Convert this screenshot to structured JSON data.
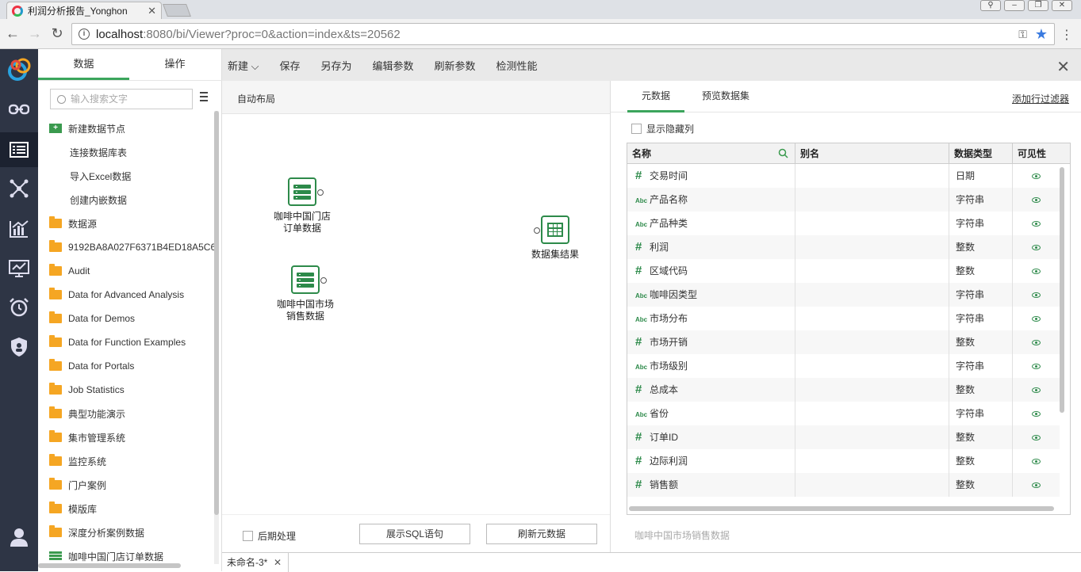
{
  "browser": {
    "tab_title": "利润分析报告_Yonghon",
    "url_host": "localhost",
    "url_path": ":8080/bi/Viewer?proc=0&action=index&ts=20562"
  },
  "left_panel": {
    "tabs": [
      "数据",
      "操作"
    ],
    "search_placeholder": "输入搜索文字",
    "tree": [
      {
        "label": "新建数据节点",
        "kind": "new"
      },
      {
        "label": "连接数据库表",
        "kind": "child"
      },
      {
        "label": "导入Excel数据",
        "kind": "child"
      },
      {
        "label": "创建内嵌数据",
        "kind": "child"
      },
      {
        "label": "数据源",
        "kind": "folder"
      },
      {
        "label": "9192BA8A027F6371B4ED18A5C6",
        "kind": "folder"
      },
      {
        "label": "Audit",
        "kind": "folder"
      },
      {
        "label": "Data for Advanced Analysis",
        "kind": "folder"
      },
      {
        "label": "Data for Demos",
        "kind": "folder"
      },
      {
        "label": "Data for Function Examples",
        "kind": "folder"
      },
      {
        "label": "Data for Portals",
        "kind": "folder"
      },
      {
        "label": "Job Statistics",
        "kind": "folder"
      },
      {
        "label": "典型功能演示",
        "kind": "folder"
      },
      {
        "label": "集市管理系统",
        "kind": "folder"
      },
      {
        "label": "监控系统",
        "kind": "folder"
      },
      {
        "label": "门户案例",
        "kind": "folder"
      },
      {
        "label": "模版库",
        "kind": "folder"
      },
      {
        "label": "深度分析案例数据",
        "kind": "folder"
      },
      {
        "label": "咖啡中国门店订单数据",
        "kind": "db"
      }
    ]
  },
  "toolbar": {
    "new_label": "新建",
    "save_label": "保存",
    "save_as_label": "另存为",
    "edit_params_label": "编辑参数",
    "refresh_params_label": "刷新参数",
    "perf_label": "检测性能"
  },
  "canvas": {
    "auto_layout": "自动布局",
    "node1": "咖啡中国门店\n订单数据",
    "node2": "咖啡中国市场\n销售数据",
    "result_node": "数据集结果",
    "post_process": "后期处理",
    "show_sql": "展示SQL语句",
    "refresh_meta": "刷新元数据"
  },
  "right_panel": {
    "tab_meta": "元数据",
    "tab_preview": "预览数据集",
    "add_filter": "添加行过滤器",
    "show_hidden": "显示隐藏列",
    "columns": [
      "名称",
      "别名",
      "数据类型",
      "可见性"
    ],
    "rows": [
      {
        "icon": "#",
        "name": "交易时间",
        "type": "日期"
      },
      {
        "icon": "Abc",
        "name": "产品名称",
        "type": "字符串"
      },
      {
        "icon": "Abc",
        "name": "产品种类",
        "type": "字符串"
      },
      {
        "icon": "#",
        "name": "利润",
        "type": "整数"
      },
      {
        "icon": "#",
        "name": "区域代码",
        "type": "整数"
      },
      {
        "icon": "Abc",
        "name": "咖啡因类型",
        "type": "字符串"
      },
      {
        "icon": "Abc",
        "name": "市场分布",
        "type": "字符串"
      },
      {
        "icon": "#",
        "name": "市场开销",
        "type": "整数"
      },
      {
        "icon": "Abc",
        "name": "市场级别",
        "type": "字符串"
      },
      {
        "icon": "#",
        "name": "总成本",
        "type": "整数"
      },
      {
        "icon": "Abc",
        "name": "省份",
        "type": "字符串"
      },
      {
        "icon": "#",
        "name": "订单ID",
        "type": "整数"
      },
      {
        "icon": "#",
        "name": "边际利润",
        "type": "整数"
      },
      {
        "icon": "#",
        "name": "销售额",
        "type": "整数"
      }
    ],
    "footer": "咖啡中国市场销售数据"
  },
  "bottom_tab": "未命名-3*",
  "colors": {
    "accent": "#3ba55c",
    "rail": "#2e3545",
    "folder": "#f5a623"
  }
}
